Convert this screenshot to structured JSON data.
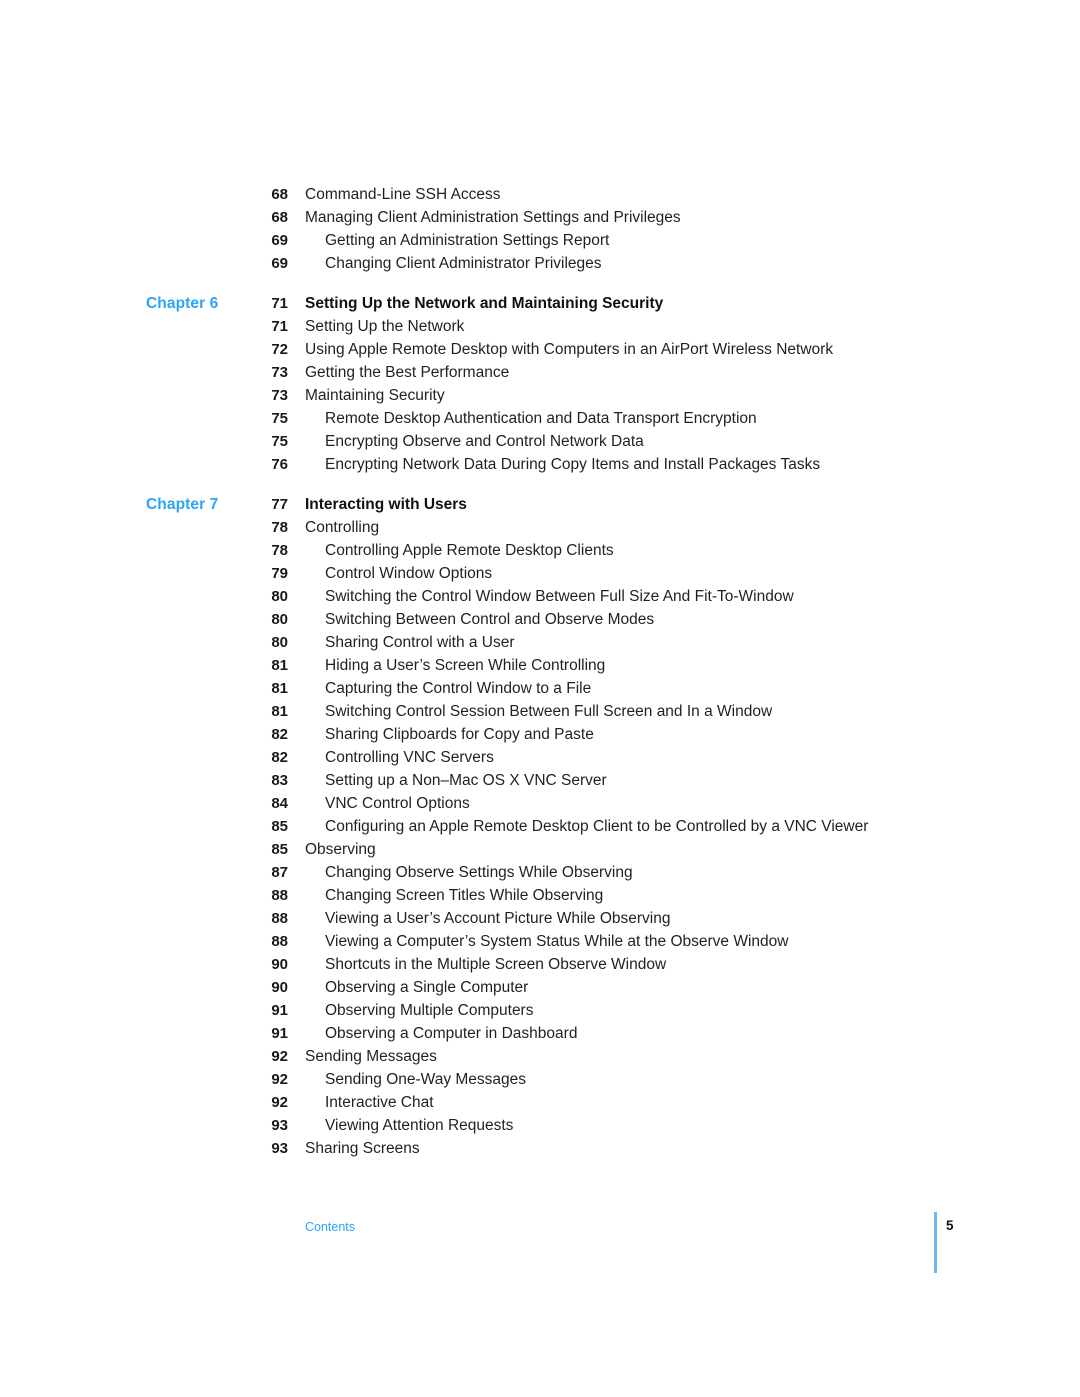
{
  "document": {
    "footer": {
      "label": "Contents",
      "page_number": "5"
    },
    "accent_color": "#2ca4f7",
    "text_color": "#231f20"
  },
  "toc": {
    "rows": [
      {
        "chapter": "",
        "page": "68",
        "title": "Command-Line SSH Access",
        "level": 1,
        "bold": false,
        "section_start": false
      },
      {
        "chapter": "",
        "page": "68",
        "title": "Managing Client Administration Settings and Privileges",
        "level": 1,
        "bold": false,
        "section_start": false
      },
      {
        "chapter": "",
        "page": "69",
        "title": "Getting an Administration Settings Report",
        "level": 2,
        "bold": false,
        "section_start": false
      },
      {
        "chapter": "",
        "page": "69",
        "title": "Changing Client Administrator Privileges",
        "level": 2,
        "bold": false,
        "section_start": false
      },
      {
        "chapter": "Chapter 6",
        "page": "71",
        "title": "Setting Up the Network and Maintaining Security",
        "level": 1,
        "bold": true,
        "section_start": true
      },
      {
        "chapter": "",
        "page": "71",
        "title": "Setting Up the Network",
        "level": 1,
        "bold": false,
        "section_start": false
      },
      {
        "chapter": "",
        "page": "72",
        "title": "Using Apple Remote Desktop with Computers in an AirPort Wireless Network",
        "level": 1,
        "bold": false,
        "section_start": false
      },
      {
        "chapter": "",
        "page": "73",
        "title": "Getting the Best Performance",
        "level": 1,
        "bold": false,
        "section_start": false
      },
      {
        "chapter": "",
        "page": "73",
        "title": "Maintaining Security",
        "level": 1,
        "bold": false,
        "section_start": false
      },
      {
        "chapter": "",
        "page": "75",
        "title": "Remote Desktop Authentication and Data Transport Encryption",
        "level": 2,
        "bold": false,
        "section_start": false
      },
      {
        "chapter": "",
        "page": "75",
        "title": "Encrypting Observe and Control Network Data",
        "level": 2,
        "bold": false,
        "section_start": false
      },
      {
        "chapter": "",
        "page": "76",
        "title": "Encrypting Network Data During Copy Items and Install Packages Tasks",
        "level": 2,
        "bold": false,
        "section_start": false
      },
      {
        "chapter": "Chapter 7",
        "page": "77",
        "title": "Interacting with Users",
        "level": 1,
        "bold": true,
        "section_start": true
      },
      {
        "chapter": "",
        "page": "78",
        "title": "Controlling",
        "level": 1,
        "bold": false,
        "section_start": false
      },
      {
        "chapter": "",
        "page": "78",
        "title": "Controlling Apple Remote Desktop Clients",
        "level": 2,
        "bold": false,
        "section_start": false
      },
      {
        "chapter": "",
        "page": "79",
        "title": "Control Window Options",
        "level": 2,
        "bold": false,
        "section_start": false
      },
      {
        "chapter": "",
        "page": "80",
        "title": "Switching the Control Window Between Full Size And Fit-To-Window",
        "level": 2,
        "bold": false,
        "section_start": false
      },
      {
        "chapter": "",
        "page": "80",
        "title": "Switching Between Control and Observe Modes",
        "level": 2,
        "bold": false,
        "section_start": false
      },
      {
        "chapter": "",
        "page": "80",
        "title": "Sharing Control with a User",
        "level": 2,
        "bold": false,
        "section_start": false
      },
      {
        "chapter": "",
        "page": "81",
        "title": "Hiding a User’s Screen While Controlling",
        "level": 2,
        "bold": false,
        "section_start": false
      },
      {
        "chapter": "",
        "page": "81",
        "title": "Capturing the Control Window to a File",
        "level": 2,
        "bold": false,
        "section_start": false
      },
      {
        "chapter": "",
        "page": "81",
        "title": "Switching Control Session Between Full Screen and In a Window",
        "level": 2,
        "bold": false,
        "section_start": false
      },
      {
        "chapter": "",
        "page": "82",
        "title": "Sharing Clipboards for Copy and Paste",
        "level": 2,
        "bold": false,
        "section_start": false
      },
      {
        "chapter": "",
        "page": "82",
        "title": "Controlling VNC Servers",
        "level": 2,
        "bold": false,
        "section_start": false
      },
      {
        "chapter": "",
        "page": "83",
        "title": "Setting up a Non–Mac OS X VNC Server",
        "level": 2,
        "bold": false,
        "section_start": false
      },
      {
        "chapter": "",
        "page": "84",
        "title": "VNC Control Options",
        "level": 2,
        "bold": false,
        "section_start": false
      },
      {
        "chapter": "",
        "page": "85",
        "title": "Configuring an Apple Remote Desktop Client to be Controlled by a VNC Viewer",
        "level": 2,
        "bold": false,
        "section_start": false
      },
      {
        "chapter": "",
        "page": "85",
        "title": "Observing",
        "level": 1,
        "bold": false,
        "section_start": false
      },
      {
        "chapter": "",
        "page": "87",
        "title": "Changing Observe Settings While Observing",
        "level": 2,
        "bold": false,
        "section_start": false
      },
      {
        "chapter": "",
        "page": "88",
        "title": "Changing Screen Titles While Observing",
        "level": 2,
        "bold": false,
        "section_start": false
      },
      {
        "chapter": "",
        "page": "88",
        "title": "Viewing a User’s Account Picture While Observing",
        "level": 2,
        "bold": false,
        "section_start": false
      },
      {
        "chapter": "",
        "page": "88",
        "title": "Viewing a Computer’s System Status While at the Observe Window",
        "level": 2,
        "bold": false,
        "section_start": false
      },
      {
        "chapter": "",
        "page": "90",
        "title": "Shortcuts in the Multiple Screen Observe Window",
        "level": 2,
        "bold": false,
        "section_start": false
      },
      {
        "chapter": "",
        "page": "90",
        "title": "Observing a Single Computer",
        "level": 2,
        "bold": false,
        "section_start": false
      },
      {
        "chapter": "",
        "page": "91",
        "title": "Observing Multiple Computers",
        "level": 2,
        "bold": false,
        "section_start": false
      },
      {
        "chapter": "",
        "page": "91",
        "title": "Observing a Computer in Dashboard",
        "level": 2,
        "bold": false,
        "section_start": false
      },
      {
        "chapter": "",
        "page": "92",
        "title": "Sending Messages",
        "level": 1,
        "bold": false,
        "section_start": false
      },
      {
        "chapter": "",
        "page": "92",
        "title": "Sending One-Way Messages",
        "level": 2,
        "bold": false,
        "section_start": false
      },
      {
        "chapter": "",
        "page": "92",
        "title": "Interactive Chat",
        "level": 2,
        "bold": false,
        "section_start": false
      },
      {
        "chapter": "",
        "page": "93",
        "title": "Viewing Attention Requests",
        "level": 2,
        "bold": false,
        "section_start": false
      },
      {
        "chapter": "",
        "page": "93",
        "title": "Sharing Screens",
        "level": 1,
        "bold": false,
        "section_start": false
      }
    ]
  }
}
